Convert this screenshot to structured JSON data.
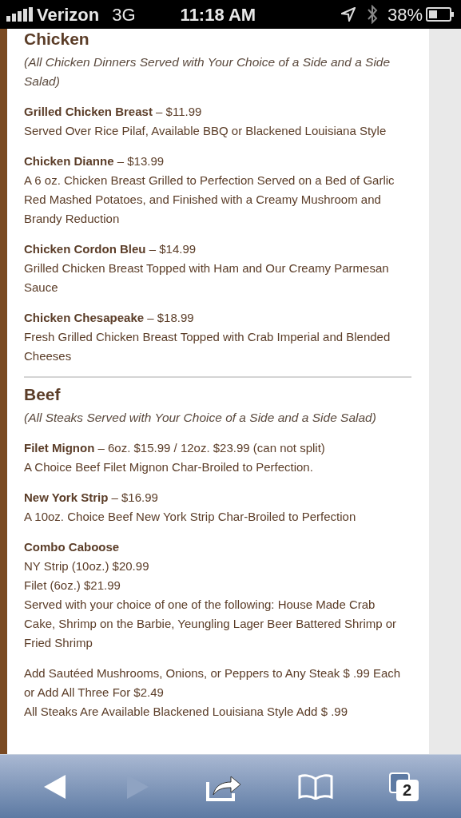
{
  "status_bar": {
    "carrier": "Verizon",
    "network": "3G",
    "time": "11:18 AM",
    "battery": "38%"
  },
  "sections": [
    {
      "heading": "Chicken",
      "note": "(All Chicken Dinners Served with Your Choice of a Side and a Side Salad)",
      "items": [
        {
          "title": "**Grilled Chicken Breast** – $11.99",
          "lines": [
            "Served Over Rice Pilaf, Available BBQ or Blackened Louisiana Style"
          ]
        },
        {
          "title": "**Chicken Dianne** – $13.99",
          "lines": [
            "A 6 oz. Chicken Breast Grilled to Perfection Served on a Bed of Garlic Red Mashed Potatoes, and Finished with a Creamy Mushroom and Brandy Reduction"
          ]
        },
        {
          "title": "**Chicken Cordon Bleu** – $14.99",
          "lines": [
            "Grilled Chicken Breast Topped with Ham and Our Creamy Parmesan Sauce"
          ]
        },
        {
          "title": "**Chicken Chesapeake** – $18.99",
          "lines": [
            "Fresh Grilled Chicken Breast Topped with Crab Imperial and Blended Cheeses"
          ]
        }
      ]
    },
    {
      "heading": "Beef",
      "note": "(All Steaks Served with Your Choice of a Side and a Side Salad)",
      "items": [
        {
          "title": "**Filet Mignon** – 6oz. $15.99 / 12oz. $23.99 (can not split)",
          "lines": [
            "A Choice Beef Filet Mignon Char-Broiled to Perfection."
          ]
        },
        {
          "title": "**New York Strip** – $16.99",
          "lines": [
            "A 10oz. Choice Beef New York Strip Char-Broiled to Perfection"
          ]
        },
        {
          "title": "**Combo Caboose**",
          "lines": [
            "NY Strip (10oz.) $20.99",
            "Filet (6oz.) $21.99",
            "Served with your choice of one of the following: House Made Crab Cake, Shrimp on the Barbie, Yeungling Lager Beer Battered Shrimp or Fried Shrimp"
          ]
        },
        {
          "lines": [
            "Add Sautéed Mushrooms, Onions, or Peppers to Any Steak $ .99 Each or Add All Three For $2.49",
            "All Steaks Are Available Blackened Louisiana Style Add $ .99"
          ]
        }
      ]
    }
  ],
  "toolbar": {
    "back": {
      "disabled": false
    },
    "forward": {
      "disabled": true
    },
    "tab_count": "2"
  }
}
